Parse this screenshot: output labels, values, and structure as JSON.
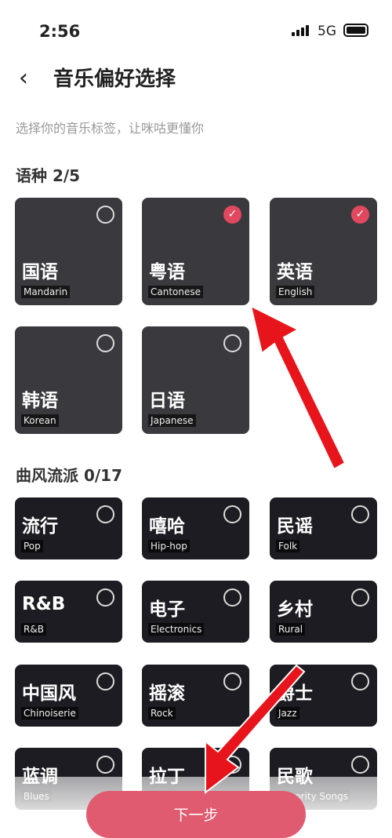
{
  "status": {
    "time": "2:56",
    "network": "5G"
  },
  "header": {
    "title": "音乐偏好选择",
    "subtitle": "选择你的音乐标签，让咪咕更懂你"
  },
  "languages": {
    "label": "语种 2/5",
    "items": [
      {
        "zh": "国语",
        "en": "Mandarin",
        "selected": false
      },
      {
        "zh": "粤语",
        "en": "Cantonese",
        "selected": true
      },
      {
        "zh": "英语",
        "en": "English",
        "selected": true
      },
      {
        "zh": "韩语",
        "en": "Korean",
        "selected": false
      },
      {
        "zh": "日语",
        "en": "Japanese",
        "selected": false
      }
    ]
  },
  "genres": {
    "label": "曲风流派 0/17",
    "items": [
      {
        "zh": "流行",
        "en": "Pop"
      },
      {
        "zh": "嘻哈",
        "en": "Hip-hop"
      },
      {
        "zh": "民谣",
        "en": "Folk"
      },
      {
        "zh": "R&B",
        "en": "R&B"
      },
      {
        "zh": "电子",
        "en": "Electronics"
      },
      {
        "zh": "乡村",
        "en": "Rural"
      },
      {
        "zh": "中国风",
        "en": "Chinoiserie"
      },
      {
        "zh": "摇滚",
        "en": "Rock"
      },
      {
        "zh": "爵士",
        "en": "Jazz"
      },
      {
        "zh": "蓝调",
        "en": "Blues"
      },
      {
        "zh": "拉丁",
        "en": "Latin"
      },
      {
        "zh": "民歌",
        "en": "Minority Songs"
      }
    ]
  },
  "next_label": "下一步",
  "colors": {
    "accent": "#e0485e",
    "annotation_arrow": "#e8141b"
  }
}
